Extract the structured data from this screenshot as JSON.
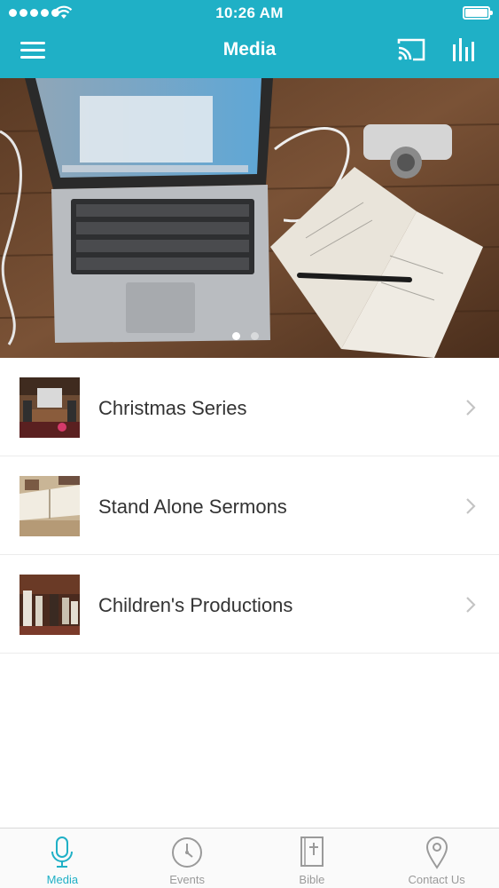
{
  "status_bar": {
    "time": "10:26 AM"
  },
  "navbar": {
    "title": "Media",
    "icons": {
      "menu": "hamburger-icon",
      "cast": "cast-icon",
      "stats": "bar-chart-icon"
    }
  },
  "hero": {
    "slide_count": 2,
    "active_slide": 1
  },
  "media_list": [
    {
      "label": "Christmas Series",
      "thumb": "church-altar-photo"
    },
    {
      "label": "Stand Alone Sermons",
      "thumb": "open-bible-photo"
    },
    {
      "label": "Children's Productions",
      "thumb": "nativity-play-photo"
    }
  ],
  "tabbar": [
    {
      "label": "Media",
      "icon": "microphone-icon",
      "active": true
    },
    {
      "label": "Events",
      "icon": "clock-icon",
      "active": false
    },
    {
      "label": "Bible",
      "icon": "bible-icon",
      "active": false
    },
    {
      "label": "Contact Us",
      "icon": "location-pin-icon",
      "active": false
    }
  ],
  "colors": {
    "accent": "#1fb0c6",
    "tab_inactive": "#9a9a9a",
    "text": "#333333"
  }
}
